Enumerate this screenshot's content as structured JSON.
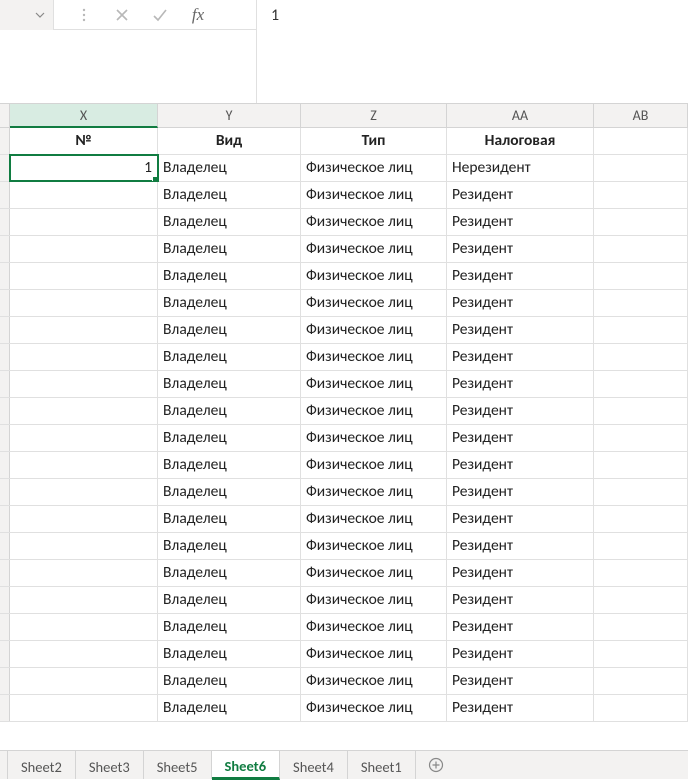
{
  "formula_bar": {
    "value": "1",
    "fx_label": "fx"
  },
  "columns": [
    "X",
    "Y",
    "Z",
    "AA",
    "AB"
  ],
  "active_column_index": 0,
  "header_row": {
    "X": "№",
    "Y": "Вид",
    "Z": "Тип",
    "AA": "Налоговая",
    "AB": ""
  },
  "selected_cell": {
    "row": 0,
    "col": "X"
  },
  "rows": [
    {
      "X": "1",
      "Y": "Владелец",
      "Z": "Физическое лиц",
      "AA": "Нерезидент"
    },
    {
      "X": "",
      "Y": "Владелец",
      "Z": "Физическое лиц",
      "AA": "Резидент"
    },
    {
      "X": "",
      "Y": "Владелец",
      "Z": "Физическое лиц",
      "AA": "Резидент"
    },
    {
      "X": "",
      "Y": "Владелец",
      "Z": "Физическое лиц",
      "AA": "Резидент"
    },
    {
      "X": "",
      "Y": "Владелец",
      "Z": "Физическое лиц",
      "AA": "Резидент"
    },
    {
      "X": "",
      "Y": "Владелец",
      "Z": "Физическое лиц",
      "AA": "Резидент"
    },
    {
      "X": "",
      "Y": "Владелец",
      "Z": "Физическое лиц",
      "AA": "Резидент"
    },
    {
      "X": "",
      "Y": "Владелец",
      "Z": "Физическое лиц",
      "AA": "Резидент"
    },
    {
      "X": "",
      "Y": "Владелец",
      "Z": "Физическое лиц",
      "AA": "Резидент"
    },
    {
      "X": "",
      "Y": "Владелец",
      "Z": "Физическое лиц",
      "AA": "Резидент"
    },
    {
      "X": "",
      "Y": "Владелец",
      "Z": "Физическое лиц",
      "AA": "Резидент"
    },
    {
      "X": "",
      "Y": "Владелец",
      "Z": "Физическое лиц",
      "AA": "Резидент"
    },
    {
      "X": "",
      "Y": "Владелец",
      "Z": "Физическое лиц",
      "AA": "Резидент"
    },
    {
      "X": "",
      "Y": "Владелец",
      "Z": "Физическое лиц",
      "AA": "Резидент"
    },
    {
      "X": "",
      "Y": "Владелец",
      "Z": "Физическое лиц",
      "AA": "Резидент"
    },
    {
      "X": "",
      "Y": "Владелец",
      "Z": "Физическое лиц",
      "AA": "Резидент"
    },
    {
      "X": "",
      "Y": "Владелец",
      "Z": "Физическое лиц",
      "AA": "Резидент"
    },
    {
      "X": "",
      "Y": "Владелец",
      "Z": "Физическое лиц",
      "AA": "Резидент"
    },
    {
      "X": "",
      "Y": "Владелец",
      "Z": "Физическое лиц",
      "AA": "Резидент"
    },
    {
      "X": "",
      "Y": "Владелец",
      "Z": "Физическое лиц",
      "AA": "Резидент"
    },
    {
      "X": "",
      "Y": "Владелец",
      "Z": "Физическое лиц",
      "AA": "Резидент"
    }
  ],
  "sheet_tabs": {
    "tabs": [
      "Sheet2",
      "Sheet3",
      "Sheet5",
      "Sheet6",
      "Sheet4",
      "Sheet1"
    ],
    "active": "Sheet6"
  }
}
